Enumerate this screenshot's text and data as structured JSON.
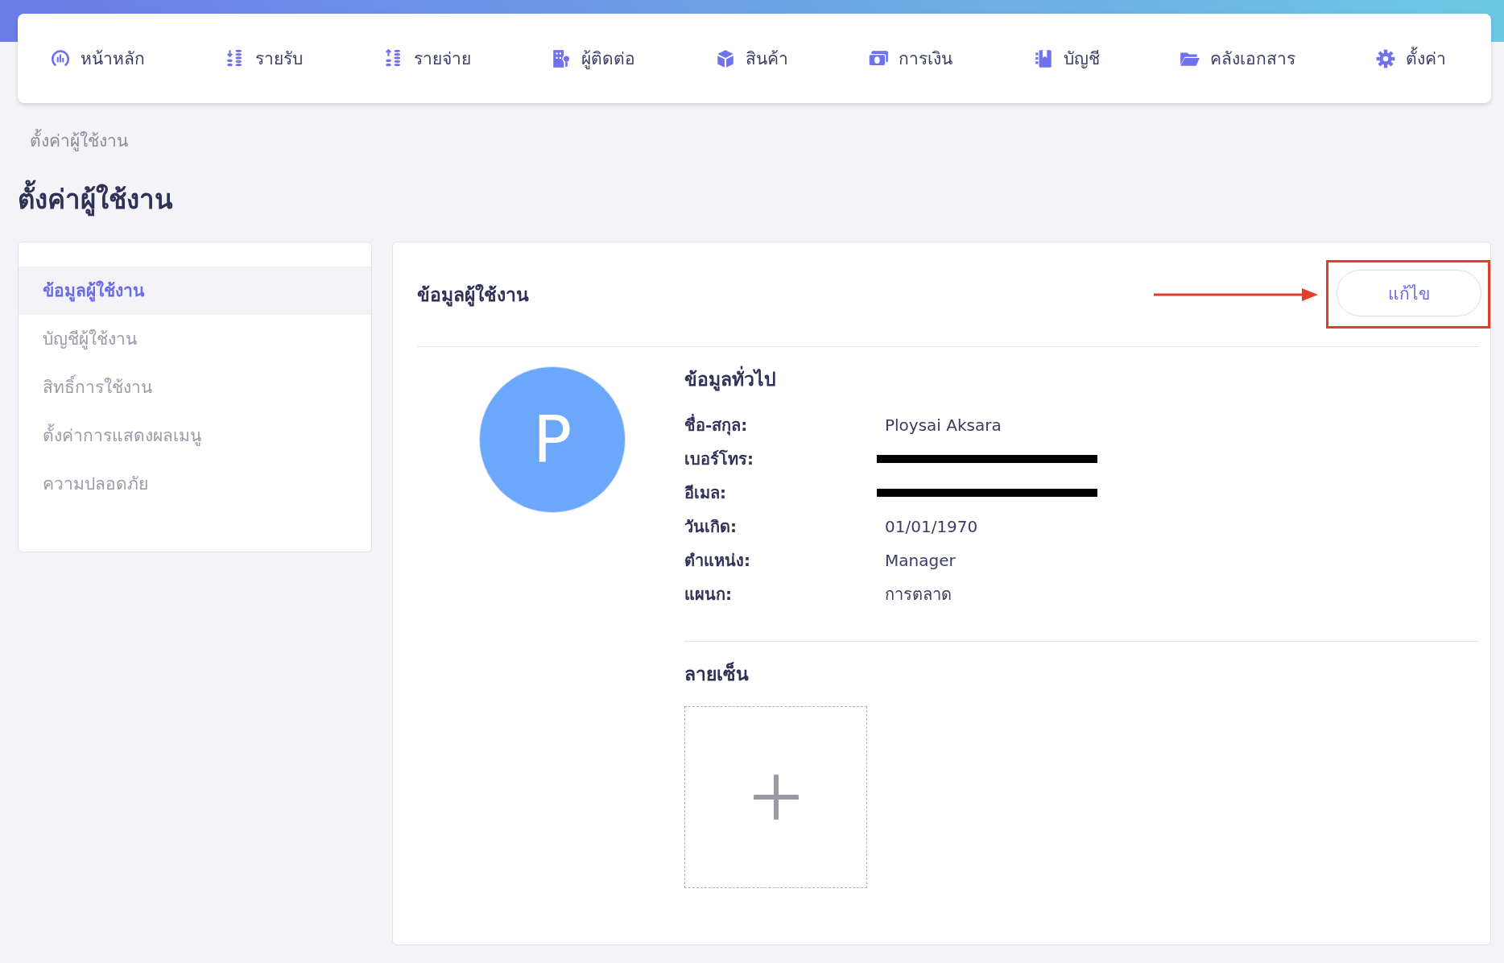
{
  "nav": [
    {
      "label": "หน้าหลัก"
    },
    {
      "label": "รายรับ"
    },
    {
      "label": "รายจ่าย"
    },
    {
      "label": "ผู้ติดต่อ"
    },
    {
      "label": "สินค้า"
    },
    {
      "label": "การเงิน"
    },
    {
      "label": "บัญชี"
    },
    {
      "label": "คลังเอกสาร"
    },
    {
      "label": "ตั้งค่า"
    }
  ],
  "breadcrumb": "ตั้งค่าผู้ใช้งาน",
  "page_title": "ตั้งค่าผู้ใช้งาน",
  "sidebar": {
    "items": [
      {
        "label": "ข้อมูลผู้ใช้งาน",
        "selected": true
      },
      {
        "label": "บัญชีผู้ใช้งาน",
        "selected": false
      },
      {
        "label": "สิทธิ์การใช้งาน",
        "selected": false
      },
      {
        "label": "ตั้งค่าการแสดงผลเมนู",
        "selected": false
      },
      {
        "label": "ความปลอดภัย",
        "selected": false
      }
    ]
  },
  "panel": {
    "title": "ข้อมูลผู้ใช้งาน",
    "edit_button": "แก้ไข",
    "avatar_letter": "P",
    "general": {
      "heading": "ข้อมูลทั่วไป",
      "fields": [
        {
          "label": "ชื่อ-สกุล:",
          "value": "Ploysai Aksara",
          "redacted": false
        },
        {
          "label": "เบอร์โทร:",
          "redacted": true
        },
        {
          "label": "อีเมล:",
          "redacted": true
        },
        {
          "label": "วันเกิด:",
          "value": "01/01/1970",
          "redacted": false
        },
        {
          "label": "ตำแหน่ง:",
          "value": "Manager",
          "redacted": false
        },
        {
          "label": "แผนก:",
          "value": "การตลาด",
          "redacted": false
        }
      ]
    },
    "signature": {
      "heading": "ลายเซ็น"
    }
  }
}
